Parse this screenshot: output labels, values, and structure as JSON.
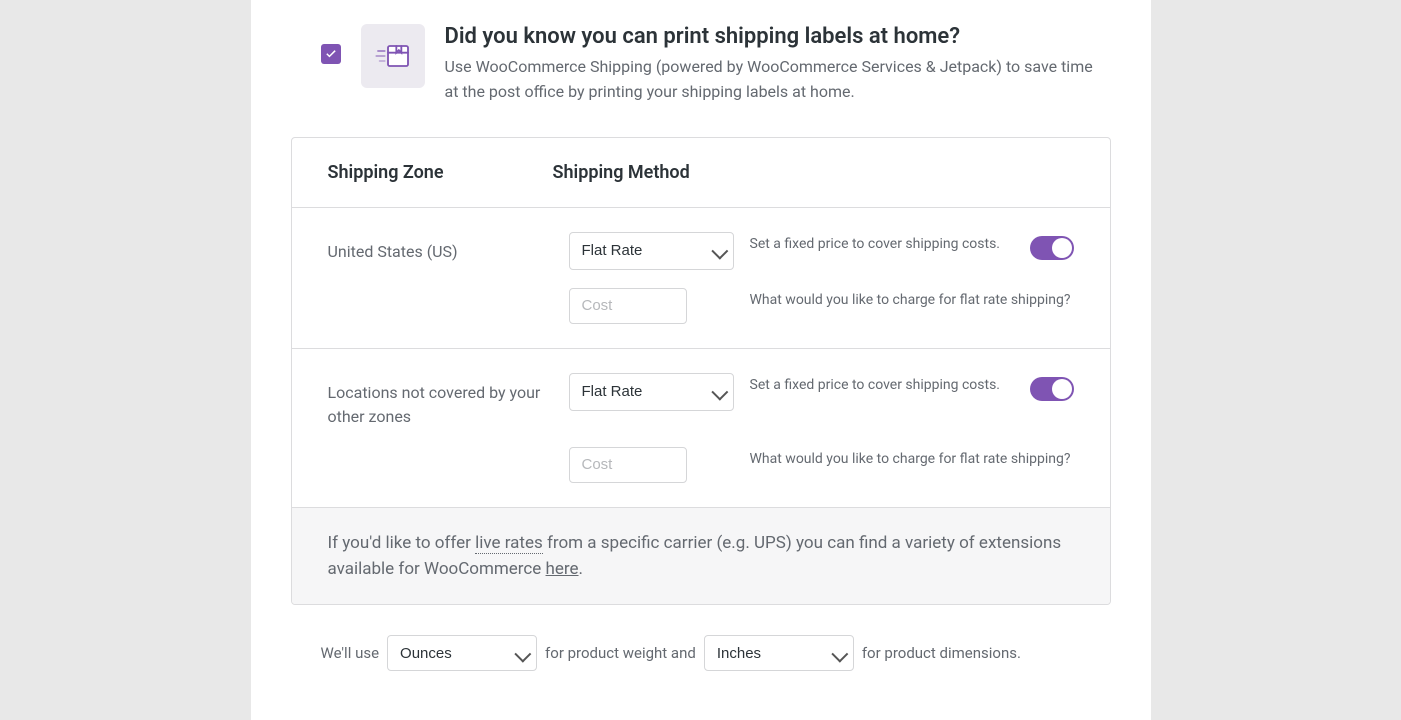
{
  "banner": {
    "title": "Did you know you can print shipping labels at home?",
    "body": "Use WooCommerce Shipping (powered by WooCommerce Services & Jetpack) to save time at the post office by printing your shipping labels at home."
  },
  "headers": {
    "zone": "Shipping Zone",
    "method": "Shipping Method"
  },
  "methodOption": "Flat Rate",
  "fixedHelp": "Set a fixed price to cover shipping costs.",
  "costHelp": "What would you like to charge for flat rate shipping?",
  "costPlaceholder": "Cost",
  "zones": [
    {
      "name": "United States (US)"
    },
    {
      "name": "Locations not covered by your other zones"
    }
  ],
  "note": {
    "pre": "If you'd like to offer ",
    "live": "live rates",
    "mid": " from a specific carrier (e.g. UPS) you can find a variety of extensions available for WooCommerce ",
    "link": "here",
    "post": "."
  },
  "units": {
    "pre": "We'll use",
    "weight": "Ounces",
    "mid": "for product weight and",
    "dim": "Inches",
    "post": "for product dimensions."
  }
}
